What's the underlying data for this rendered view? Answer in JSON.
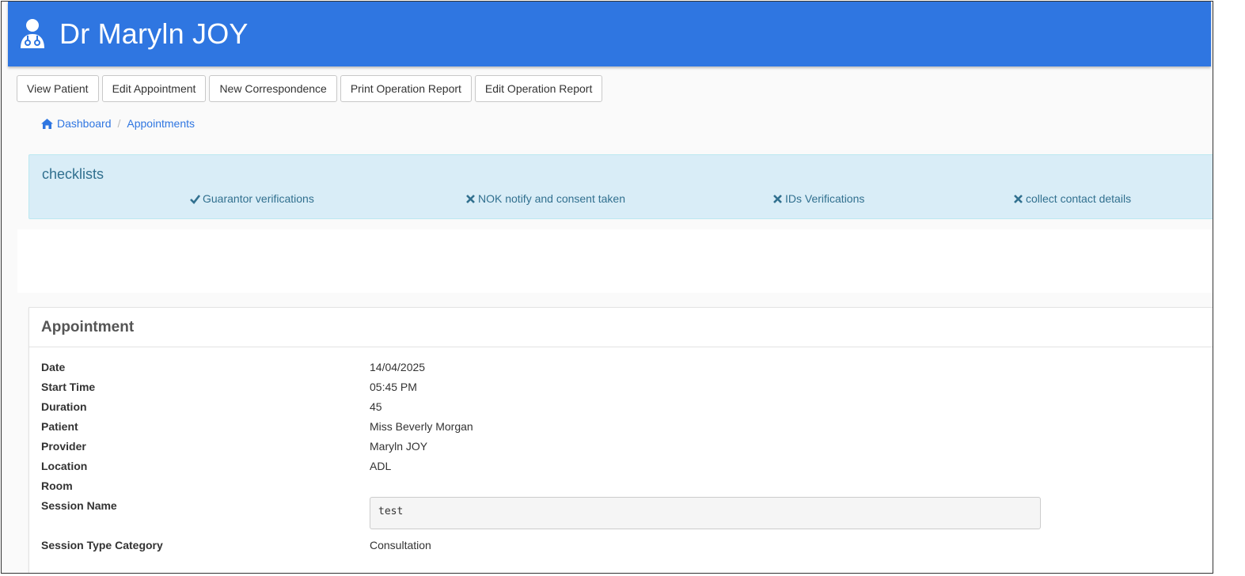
{
  "header": {
    "title": "Dr Maryln JOY",
    "icon": "doctor-icon"
  },
  "toolbar": {
    "buttons": [
      "View Patient",
      "Edit Appointment",
      "New Correspondence",
      "Print Operation Report",
      "Edit Operation Report"
    ]
  },
  "breadcrumb": {
    "home": "Dashboard",
    "current": "Appointments"
  },
  "checklists": {
    "title": "checklists",
    "items": [
      {
        "label": "Guarantor verifications",
        "status": "check"
      },
      {
        "label": "NOK notify and consent taken",
        "status": "cross"
      },
      {
        "label": "IDs Verifications",
        "status": "cross"
      },
      {
        "label": "collect contact details",
        "status": "cross"
      }
    ]
  },
  "appointment": {
    "title": "Appointment",
    "fields": [
      {
        "label": "Date",
        "value": "14/04/2025"
      },
      {
        "label": "Start Time",
        "value": "05:45 PM"
      },
      {
        "label": "Duration",
        "value": "45"
      },
      {
        "label": "Patient",
        "value": "Miss Beverly Morgan"
      },
      {
        "label": "Provider",
        "value": "Maryln JOY"
      },
      {
        "label": "Location",
        "value": "ADL"
      },
      {
        "label": "Room",
        "value": ""
      },
      {
        "label": "Session Name",
        "value": "test"
      },
      {
        "label": "Session Type Category",
        "value": "Consultation"
      }
    ]
  },
  "colors": {
    "header": "#2f76e1",
    "checklist_bg": "#d9edf7",
    "checklist_text": "#31708f"
  }
}
